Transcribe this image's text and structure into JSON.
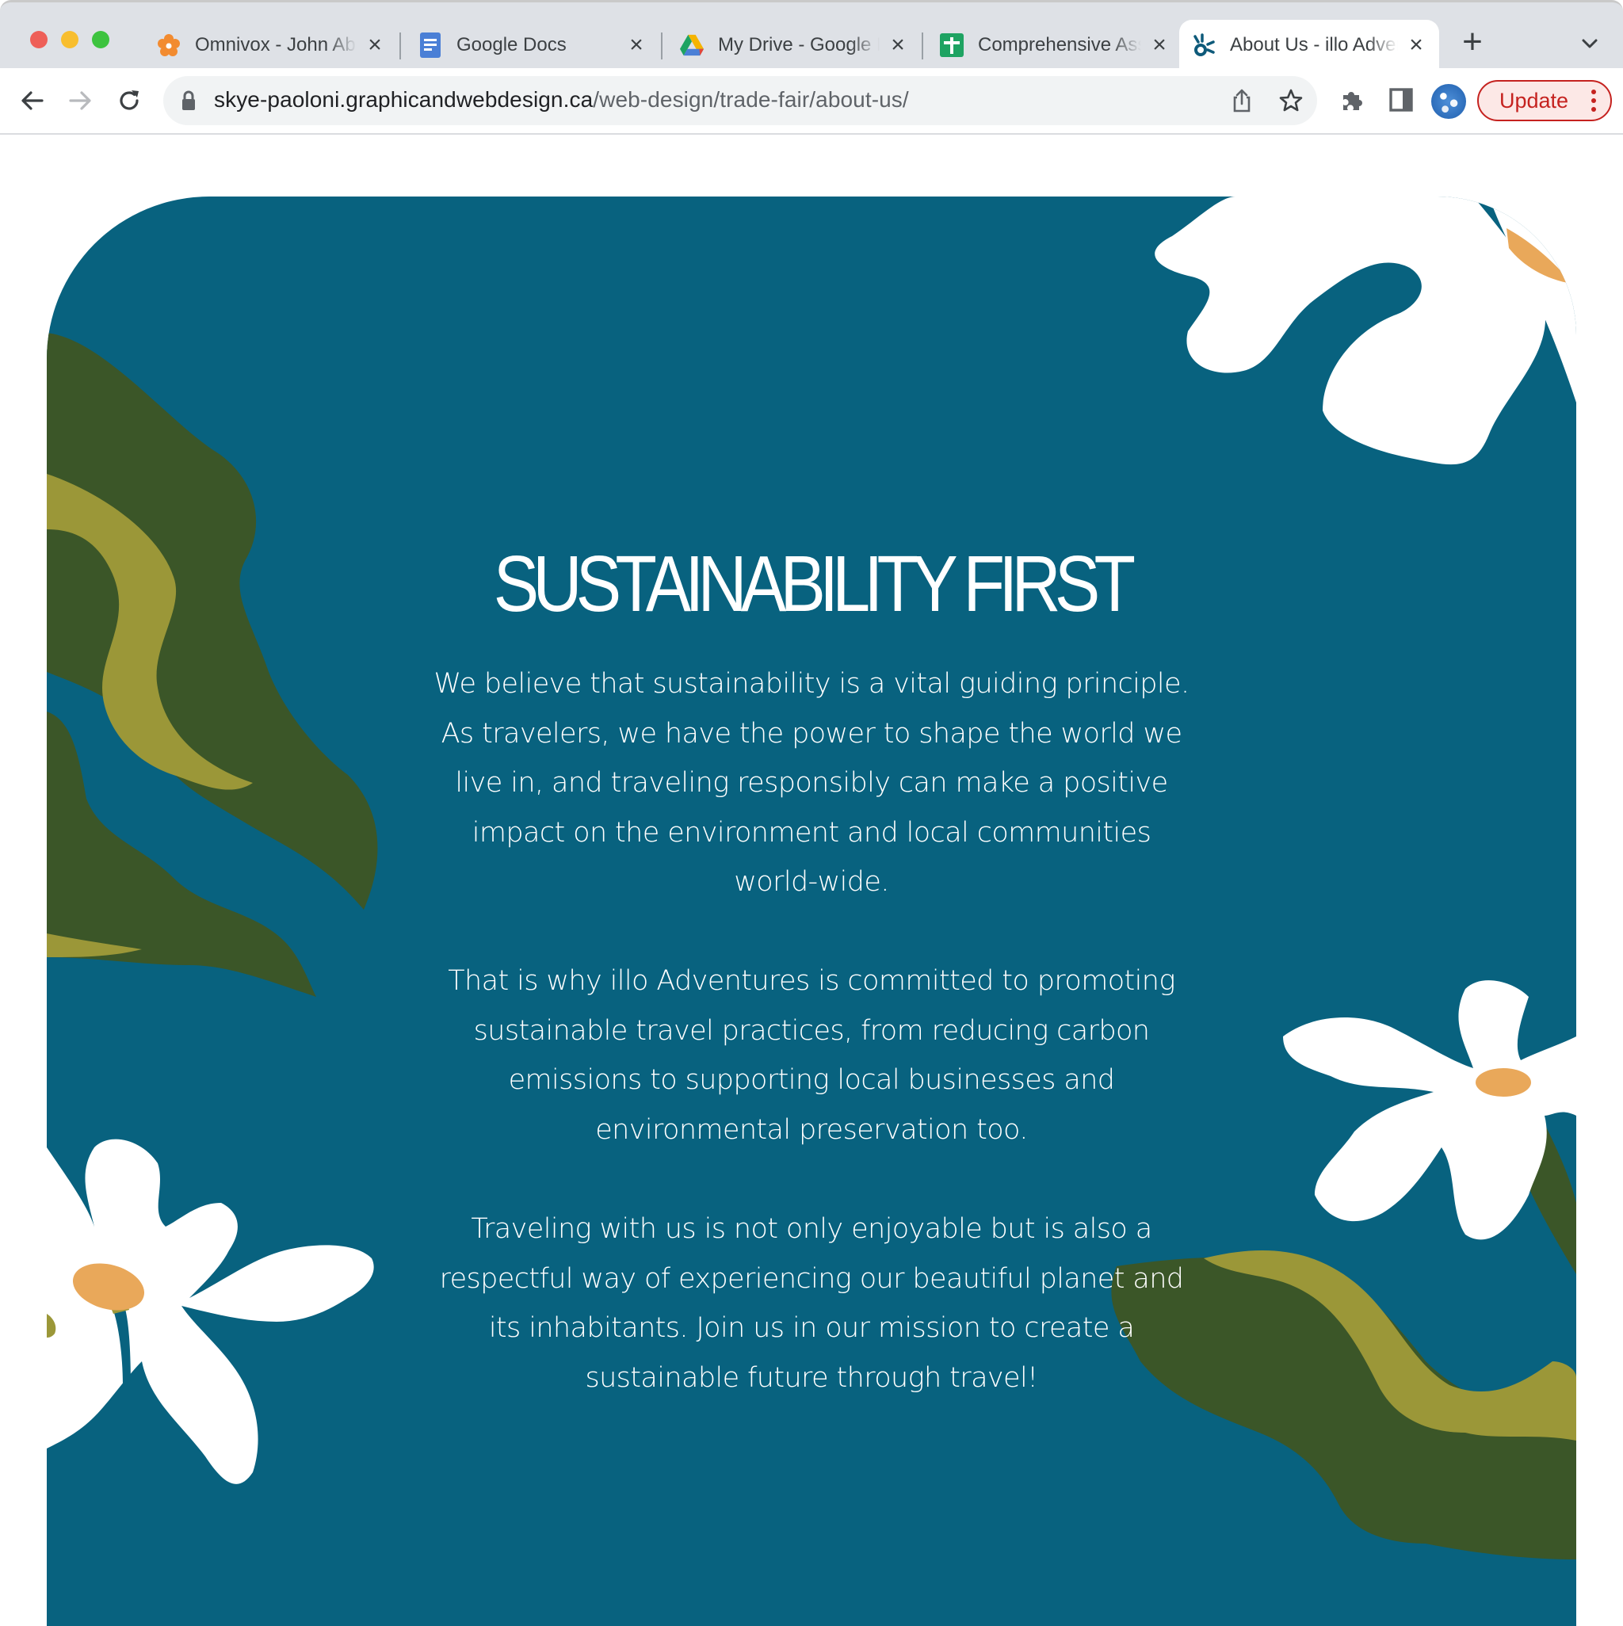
{
  "browser": {
    "tabs": [
      {
        "title": "Omnivox - John Abbott College",
        "favicon": "omnivox-flower-icon",
        "active": false
      },
      {
        "title": "Google Docs",
        "favicon": "google-docs-icon",
        "active": false
      },
      {
        "title": "My Drive - Google Drive",
        "favicon": "google-drive-icon",
        "active": false
      },
      {
        "title": "Comprehensive Assignment",
        "favicon": "google-sheets-icon",
        "active": false
      },
      {
        "title": "About Us - illo Adventures",
        "favicon": "illo-logo-icon",
        "active": true
      }
    ],
    "new_tab_label": "+",
    "url_host": "skye-paoloni.graphicandwebdesign.ca",
    "url_path": "/web-design/trade-fair/about-us/",
    "update_label": "Update"
  },
  "page": {
    "headline": "SUSTAINABILITY FIRST",
    "paragraphs": [
      {
        "lines": [
          "We believe that sustainability is a vital guiding principle.",
          "As travelers, we have the power to shape the world we",
          "live in, and traveling responsibly can make a positive",
          "impact on the environment and local communities",
          "world-wide."
        ]
      },
      {
        "lines": [
          "That is why illo Adventures is committed to promoting",
          "sustainable travel practices, from reducing carbon",
          "emissions to supporting local businesses and",
          "environmental preservation too."
        ]
      },
      {
        "lines": [
          "Traveling with us is not only enjoyable but is also a",
          "respectful way of experiencing our beautiful planet and",
          "its inhabitants. Join us in our mission to create a",
          "sustainable future through travel!"
        ]
      }
    ],
    "colors": {
      "panel": "#08627f",
      "leaf_dark": "#3b5628",
      "leaf_light": "#9b9738",
      "petal": "#ffffff",
      "flower_center": "#e9a85a"
    }
  }
}
